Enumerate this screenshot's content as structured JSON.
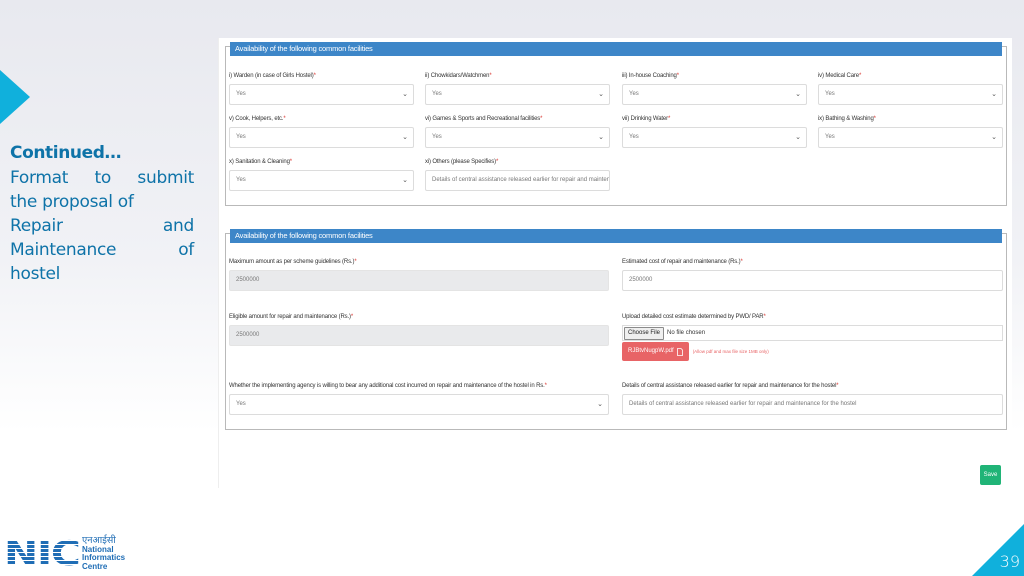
{
  "slide": {
    "side_title": "Continued…",
    "side_lines": [
      [
        "Format",
        "to",
        "submit"
      ],
      [
        "the proposal of"
      ],
      [
        "Repair",
        "and"
      ],
      [
        "Maintenance",
        "of"
      ],
      [
        "hostel"
      ]
    ],
    "page_number": "39",
    "accent_color": "#10b0dc"
  },
  "logo": {
    "mark": "NIC",
    "hindi": "एनआईसी",
    "line1": "National",
    "line2": "Informatics",
    "line3": "Centre"
  },
  "form": {
    "section1": {
      "header": "Availability of the following common facilities",
      "fields": [
        {
          "label": "i) Warden (in case of Girls Hostel)",
          "value": "Yes"
        },
        {
          "label": "ii) Chowkidars/Watchmen",
          "value": "Yes"
        },
        {
          "label": "iii) In-house Coaching",
          "value": "Yes"
        },
        {
          "label": "iv) Medical Care",
          "value": "Yes"
        },
        {
          "label": "v) Cook, Helpers, etc.",
          "value": "Yes"
        },
        {
          "label": "vi) Games & Sports and Recreational facilities",
          "value": "Yes"
        },
        {
          "label": "vii) Drinking Water",
          "value": "Yes"
        },
        {
          "label": "ix) Bathing & Washing",
          "value": "Yes"
        },
        {
          "label": "x) Sanitation & Cleaning",
          "value": "Yes"
        },
        {
          "label": "xi) Others (please Specifies)",
          "value": "Details of central assistance released earlier for repair and maintenance for t"
        }
      ]
    },
    "section2": {
      "header": "Availability of the following common facilities",
      "max_amount": {
        "label": "Maximum amount as per scheme guidelines (Rs.)",
        "value": "2500000"
      },
      "estimated_cost": {
        "label": "Estimated cost of repair and maintenance (Rs.)",
        "value": "2500000"
      },
      "eligible_amount": {
        "label": "Eligible amount for repair and maintenance (Rs.)",
        "value": "2500000"
      },
      "upload": {
        "label": "Upload detailed cost estimate determined by PWD/ PAR",
        "button": "Choose File",
        "status": "No file chosen",
        "file_name": "RJBtvNugpW.pdf",
        "hint": "(Allow pdf and max file size 1MB only)"
      },
      "willing": {
        "label": "Whether the implementing agency is willing to bear any additional cost incurred on repair and maintenance of the hostel in Rs.",
        "value": "Yes"
      },
      "central_assistance": {
        "label": "Details of central assistance released earlier for repair and maintenance for the hostel",
        "value": "Details of central assistance released earlier for repair and maintenance for the hostel"
      }
    },
    "required_marker": "*",
    "save_label": "Save",
    "colors": {
      "header": "#3d86c8",
      "save": "#20b477",
      "file_badge": "#e86466",
      "required": "#d9312b"
    }
  }
}
